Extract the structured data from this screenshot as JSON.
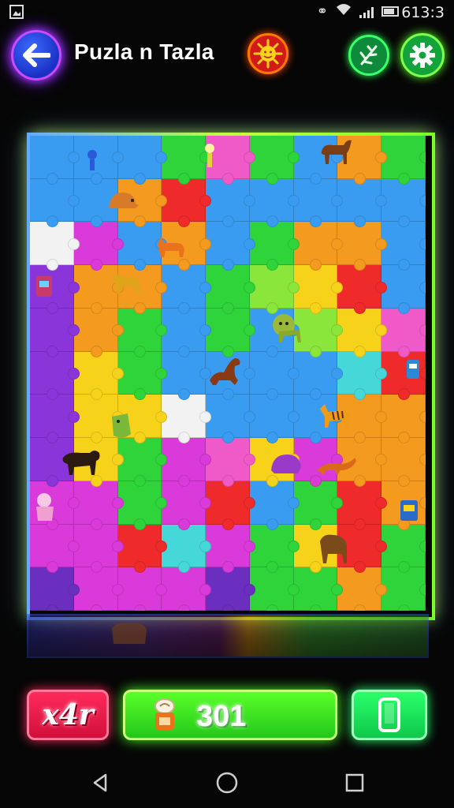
{
  "status": {
    "time": "613:3",
    "icons": [
      "gallery-notification-icon",
      "nfc-icon",
      "wifi-icon",
      "signal-icon",
      "battery-icon"
    ]
  },
  "header": {
    "title": "Puzla n Tazla",
    "icons": [
      "back-arrow-icon",
      "sun-icon",
      "leaf-icon",
      "gear-icon"
    ]
  },
  "board": {
    "columns": 9,
    "rows": 11,
    "colors": {
      "blue": "#3a9cf0",
      "green": "#2fd43a",
      "red": "#ef2a2a",
      "orange": "#f39a1f",
      "yellow": "#f7d21a",
      "magenta": "#d93ad9",
      "purple": "#8a35d9",
      "pink": "#f05ac8",
      "white": "#f2f2f2",
      "cyan": "#46d8d8",
      "lime": "#8ae63a",
      "violet": "#6b2fc0"
    },
    "pieces": [
      [
        "blue",
        "blue",
        "blue",
        "green",
        "pink",
        "green",
        "blue",
        "orange",
        "green"
      ],
      [
        "blue",
        "blue",
        "orange",
        "red",
        "blue",
        "blue",
        "blue",
        "blue",
        "blue"
      ],
      [
        "white",
        "magenta",
        "blue",
        "orange",
        "blue",
        "green",
        "orange",
        "orange",
        "blue"
      ],
      [
        "purple",
        "orange",
        "orange",
        "blue",
        "green",
        "lime",
        "yellow",
        "red",
        "blue"
      ],
      [
        "purple",
        "orange",
        "green",
        "blue",
        "green",
        "blue",
        "lime",
        "yellow",
        "pink"
      ],
      [
        "purple",
        "yellow",
        "green",
        "blue",
        "blue",
        "blue",
        "blue",
        "cyan",
        "red"
      ],
      [
        "purple",
        "yellow",
        "yellow",
        "white",
        "blue",
        "blue",
        "blue",
        "orange",
        "orange"
      ],
      [
        "purple",
        "yellow",
        "green",
        "magenta",
        "pink",
        "yellow",
        "magenta",
        "orange",
        "orange"
      ],
      [
        "magenta",
        "magenta",
        "green",
        "magenta",
        "red",
        "blue",
        "green",
        "red",
        "orange"
      ],
      [
        "magenta",
        "magenta",
        "red",
        "cyan",
        "magenta",
        "green",
        "yellow",
        "red",
        "green"
      ],
      [
        "violet",
        "magenta",
        "magenta",
        "magenta",
        "violet",
        "green",
        "green",
        "orange",
        "green"
      ]
    ]
  },
  "bottom_bar": {
    "multiplier_label": "x4r",
    "score": "301",
    "icons": [
      "coin-bag-icon",
      "phone-icon"
    ]
  },
  "navbar": {
    "icons": [
      "nav-back-icon",
      "nav-home-icon",
      "nav-recents-icon"
    ]
  }
}
